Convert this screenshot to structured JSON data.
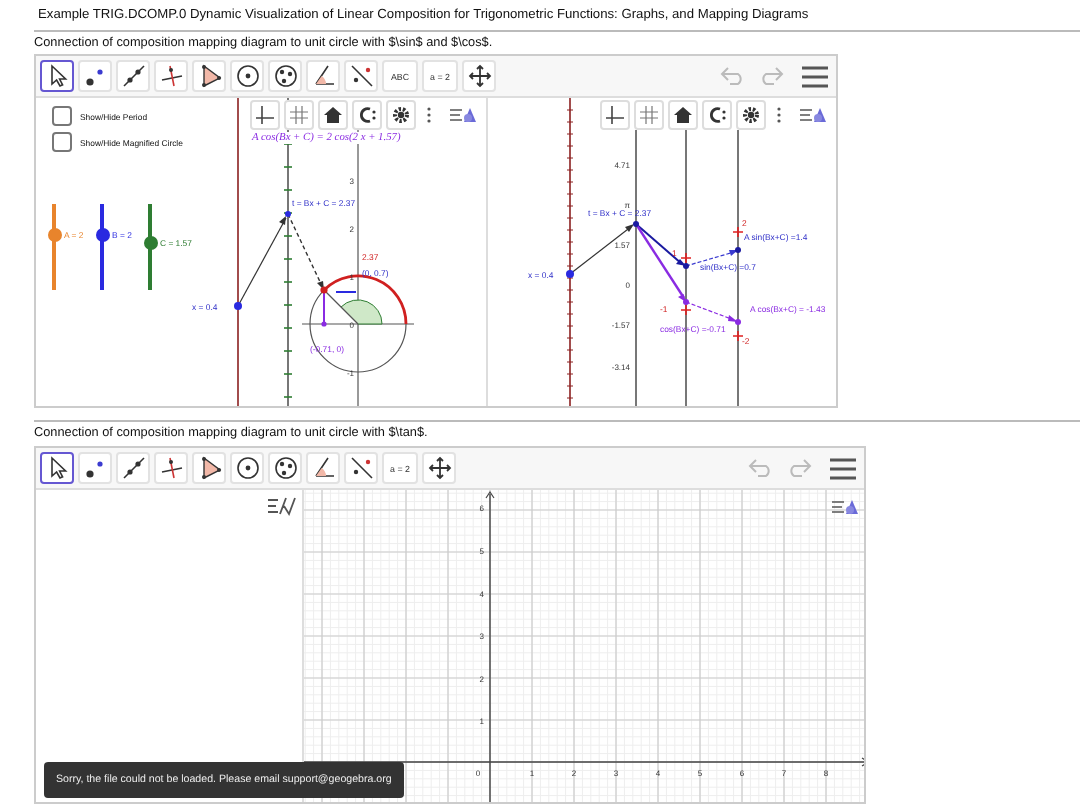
{
  "page_title": "Example TRIG.DCOMP.0 Dynamic Visualization of Linear Composition for  Trigonometric Functions: Graphs, and Mapping Diagrams",
  "applets": [
    {
      "caption": "Connection of composition mapping diagram to unit circle with $\\sin$ and $\\cos$.",
      "tools": [
        {
          "kind": "move",
          "selected": true
        },
        {
          "kind": "point",
          "selected": false
        },
        {
          "kind": "line",
          "selected": false
        },
        {
          "kind": "perpendicular",
          "selected": false
        },
        {
          "kind": "polygon",
          "selected": false
        },
        {
          "kind": "circle",
          "selected": false
        },
        {
          "kind": "conic",
          "selected": false
        },
        {
          "kind": "angle",
          "selected": false
        },
        {
          "kind": "reflect",
          "selected": false
        },
        {
          "kind": "text",
          "label": "ABC",
          "selected": false
        },
        {
          "kind": "slider",
          "label": "a = 2",
          "selected": false
        },
        {
          "kind": "pan",
          "selected": false
        }
      ],
      "views": [
        {
          "kind": "circle",
          "checkboxes": [
            {
              "label": "Show/Hide Period",
              "checked": false
            },
            {
              "label": "Show/Hide Magnified Circle",
              "checked": false
            }
          ],
          "sliders": [
            {
              "label": "A = 2",
              "color": "#e8842c",
              "level": 0.7
            },
            {
              "label": "B = 2",
              "color": "#2a2ae0",
              "level": 0.7
            },
            {
              "label": "C = 1.57",
              "color": "#2e7d32",
              "level": 0.6
            }
          ],
          "formula": "A cos(Bx + C) = 2 cos(2 x + 1.57)",
          "axis_labels": [
            "3",
            "2",
            "1",
            "0",
            "-1"
          ],
          "labels": [
            "t = Bx + C = 2.37",
            "x = 0.4",
            "2.37",
            "(0, 0.7)",
            "(-0.71, 0)"
          ]
        },
        {
          "kind": "mapping",
          "axis_labels": [
            "4.71",
            "π",
            "1.57",
            "0",
            "-1.57",
            "-3.14"
          ],
          "labels": [
            "t = Bx + C = 2.37",
            "x = 0.4",
            "A sin(Bx+C) =1.4",
            "sin(Bx+C) =0.7",
            "cos(Bx+C) =-0.71",
            "A cos(Bx+C) = -1.43",
            "2",
            "1",
            "-1",
            "-2"
          ]
        }
      ]
    },
    {
      "caption": "Connection of composition mapping diagram to unit circle with $\\tan$.",
      "tools": [
        {
          "kind": "move",
          "selected": true
        },
        {
          "kind": "point",
          "selected": false
        },
        {
          "kind": "line",
          "selected": false
        },
        {
          "kind": "perpendicular",
          "selected": false
        },
        {
          "kind": "polygon",
          "selected": false
        },
        {
          "kind": "circle",
          "selected": false
        },
        {
          "kind": "conic",
          "selected": false
        },
        {
          "kind": "angle",
          "selected": false
        },
        {
          "kind": "reflect",
          "selected": false
        },
        {
          "kind": "slider",
          "label": "a = 2",
          "selected": false
        },
        {
          "kind": "pan",
          "selected": false
        }
      ],
      "views": [
        {
          "kind": "algebra"
        },
        {
          "kind": "grid",
          "y_ticks": [
            "6",
            "5",
            "4",
            "3",
            "2",
            "1"
          ],
          "x_ticks": [
            "0",
            "1",
            "2",
            "3",
            "4",
            "5",
            "6",
            "7",
            "8"
          ]
        }
      ],
      "toast": "Sorry, the file could not be loaded. Please email support@geogebra.org"
    }
  ]
}
